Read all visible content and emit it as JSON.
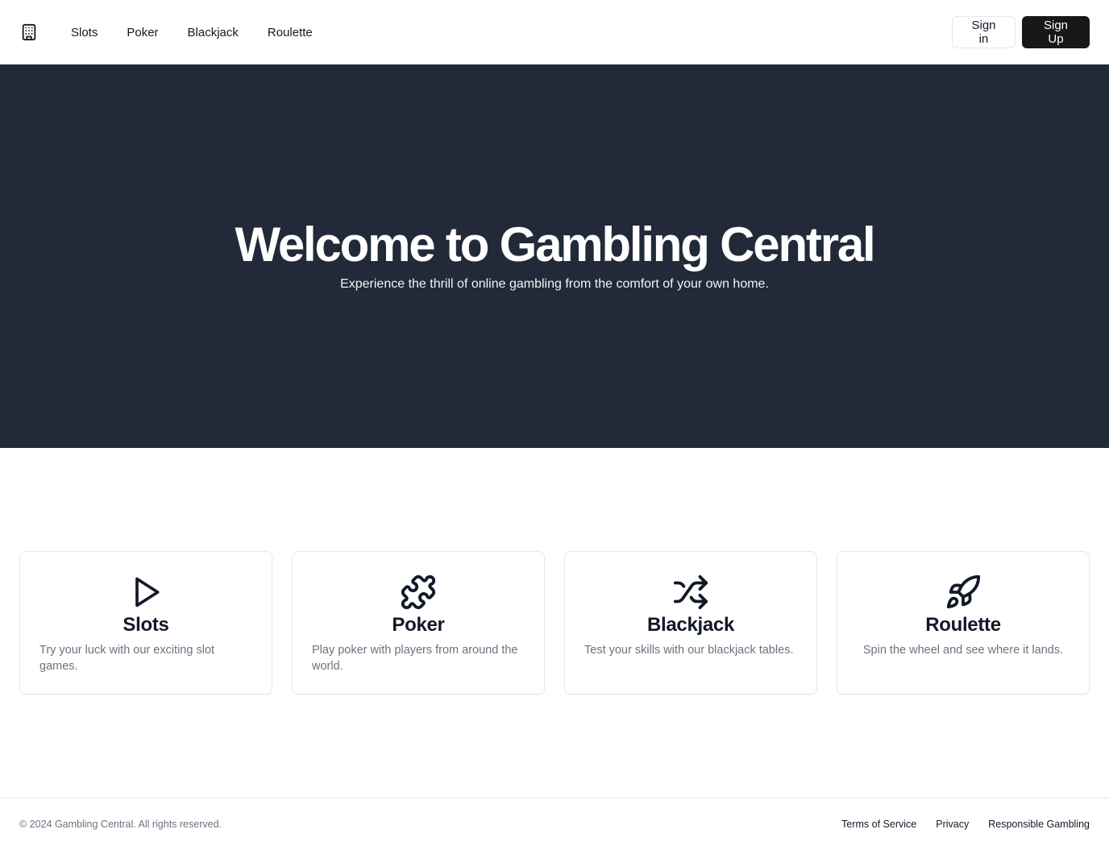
{
  "header": {
    "logo_icon": "building-icon",
    "nav": [
      {
        "label": "Slots"
      },
      {
        "label": "Poker"
      },
      {
        "label": "Blackjack"
      },
      {
        "label": "Roulette"
      }
    ],
    "signin_label": "Sign in",
    "signup_label": "Sign Up"
  },
  "hero": {
    "title": "Welcome to Gambling Central",
    "subtitle": "Experience the thrill of online gambling from the comfort of your own home.",
    "background": "#222938"
  },
  "cards": [
    {
      "icon": "play-icon",
      "title": "Slots",
      "description": "Try your luck with our exciting slot games."
    },
    {
      "icon": "puzzle-icon",
      "title": "Poker",
      "description": "Play poker with players from around the world."
    },
    {
      "icon": "shuffle-icon",
      "title": "Blackjack",
      "description": "Test your skills with our blackjack tables."
    },
    {
      "icon": "rocket-icon",
      "title": "Roulette",
      "description": "Spin the wheel and see where it lands."
    }
  ],
  "footer": {
    "copyright": "© 2024 Gambling Central. All rights reserved.",
    "links": [
      {
        "label": "Terms of Service"
      },
      {
        "label": "Privacy"
      },
      {
        "label": "Responsible Gambling"
      }
    ]
  },
  "colors": {
    "accent_dark": "#18181b",
    "muted_text": "#6b7280",
    "border": "#e5e7eb"
  }
}
